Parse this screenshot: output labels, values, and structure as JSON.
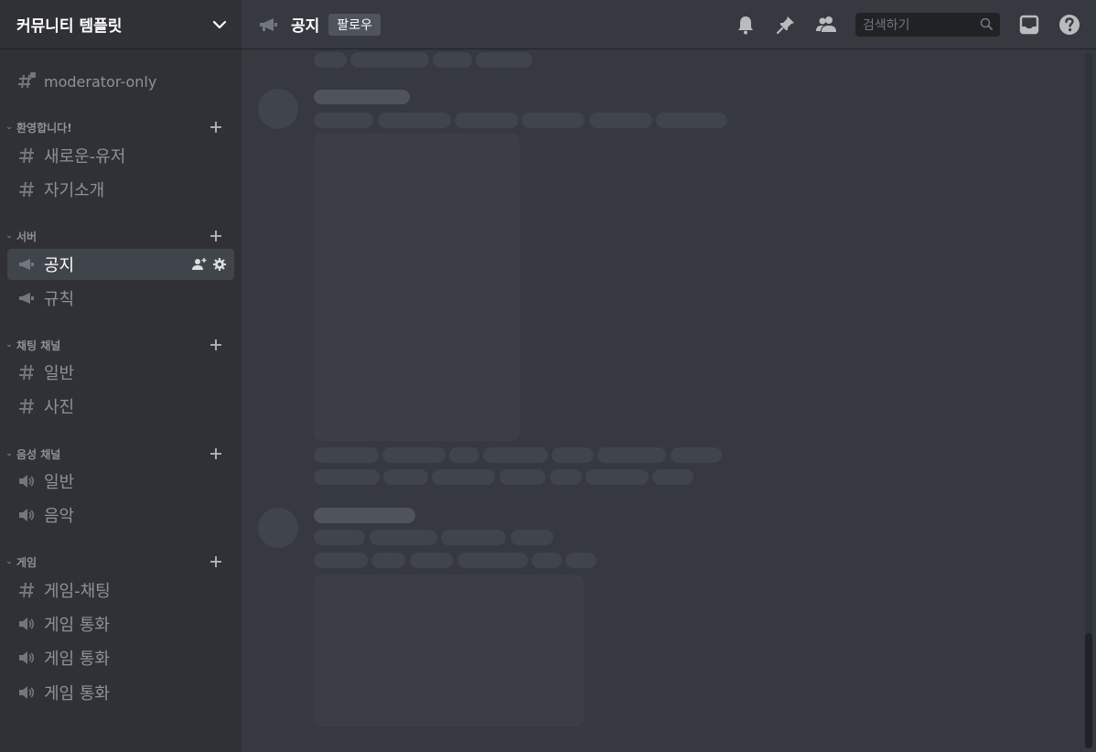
{
  "server": {
    "name": "커뮤니티 템플릿"
  },
  "sidebar": {
    "top_channel": {
      "label": "moderator-only",
      "icon": "locked-hashtag-icon"
    },
    "categories": [
      {
        "label": "환영합니다!",
        "channels": [
          {
            "label": "새로운-유저",
            "icon": "hashtag-icon"
          },
          {
            "label": "자기소개",
            "icon": "hashtag-icon"
          }
        ]
      },
      {
        "label": "서버",
        "channels": [
          {
            "label": "공지",
            "icon": "megaphone-icon",
            "active": true
          },
          {
            "label": "규칙",
            "icon": "megaphone-icon"
          }
        ]
      },
      {
        "label": "채팅 채널",
        "channels": [
          {
            "label": "일반",
            "icon": "hashtag-icon"
          },
          {
            "label": "사진",
            "icon": "hashtag-icon"
          }
        ]
      },
      {
        "label": "음성 채널",
        "channels": [
          {
            "label": "일반",
            "icon": "speaker-icon"
          },
          {
            "label": "음악",
            "icon": "speaker-icon"
          }
        ]
      },
      {
        "label": "게임",
        "channels": [
          {
            "label": "게임-채팅",
            "icon": "hashtag-icon"
          },
          {
            "label": "게임 통화",
            "icon": "speaker-icon"
          },
          {
            "label": "게임 통화",
            "icon": "speaker-icon"
          },
          {
            "label": "게임 통화",
            "icon": "speaker-icon"
          }
        ]
      }
    ]
  },
  "header": {
    "channel_name": "공지",
    "follow_label": "팔로우",
    "search_placeholder": "검색하기"
  },
  "colors": {
    "sidebar_bg": "#2f3136",
    "main_bg": "#36393f",
    "active_channel_bg": "#40444b",
    "text_muted": "#8e9297",
    "skeleton": "#40444b"
  }
}
